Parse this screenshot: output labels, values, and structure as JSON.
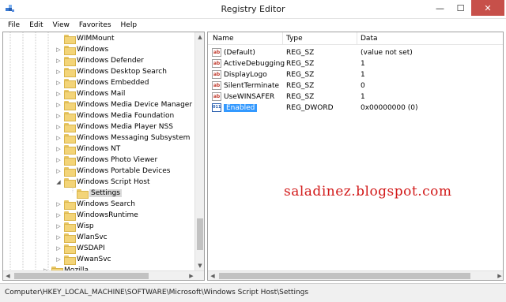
{
  "window": {
    "title": "Registry Editor",
    "minimize_glyph": "—",
    "maximize_glyph": "☐",
    "close_glyph": "✕",
    "app_icon": "regedit-cube-icon"
  },
  "menu": {
    "items": [
      "File",
      "Edit",
      "View",
      "Favorites",
      "Help"
    ]
  },
  "tree": {
    "items": [
      {
        "label": "WIMMount",
        "expander": ""
      },
      {
        "label": "Windows",
        "expander": "▷"
      },
      {
        "label": "Windows Defender",
        "expander": "▷"
      },
      {
        "label": "Windows Desktop Search",
        "expander": "▷"
      },
      {
        "label": "Windows Embedded",
        "expander": "▷"
      },
      {
        "label": "Windows Mail",
        "expander": "▷"
      },
      {
        "label": "Windows Media Device Manager",
        "expander": "▷"
      },
      {
        "label": "Windows Media Foundation",
        "expander": "▷"
      },
      {
        "label": "Windows Media Player NSS",
        "expander": "▷"
      },
      {
        "label": "Windows Messaging Subsystem",
        "expander": "▷"
      },
      {
        "label": "Windows NT",
        "expander": "▷"
      },
      {
        "label": "Windows Photo Viewer",
        "expander": "▷"
      },
      {
        "label": "Windows Portable Devices",
        "expander": "▷"
      },
      {
        "label": "Windows Script Host",
        "expander": "◢"
      },
      {
        "label": "Settings",
        "expander": "",
        "selected": true,
        "child": true
      },
      {
        "label": "Windows Search",
        "expander": "▷"
      },
      {
        "label": "WindowsRuntime",
        "expander": "▷"
      },
      {
        "label": "Wisp",
        "expander": "▷"
      },
      {
        "label": "WlanSvc",
        "expander": "▷"
      },
      {
        "label": "WSDAPI",
        "expander": "▷"
      },
      {
        "label": "WwanSvc",
        "expander": "▷"
      },
      {
        "label": "Mozilla",
        "expander": "▷",
        "root_level": true
      }
    ]
  },
  "values_list": {
    "headers": {
      "name": "Name",
      "type": "Type",
      "data": "Data"
    },
    "rows": [
      {
        "icon": "ab",
        "name": "(Default)",
        "type": "REG_SZ",
        "data": "(value not set)"
      },
      {
        "icon": "ab",
        "name": "ActiveDebugging",
        "type": "REG_SZ",
        "data": "1"
      },
      {
        "icon": "ab",
        "name": "DisplayLogo",
        "type": "REG_SZ",
        "data": "1"
      },
      {
        "icon": "ab",
        "name": "SilentTerminate",
        "type": "REG_SZ",
        "data": "0"
      },
      {
        "icon": "ab",
        "name": "UseWINSAFER",
        "type": "REG_SZ",
        "data": "1"
      },
      {
        "icon": "011",
        "name": "Enabled",
        "type": "REG_DWORD",
        "data": "0x00000000 (0)",
        "selected": true
      }
    ]
  },
  "watermark": "saladinez.blogspot.com",
  "status": {
    "path": "Computer\\HKEY_LOCAL_MACHINE\\SOFTWARE\\Microsoft\\Windows Script Host\\Settings"
  },
  "colors": {
    "selection": "#3399ff",
    "close_button": "#c7504a",
    "watermark": "#d21a1a",
    "folder": "#f3d478"
  }
}
